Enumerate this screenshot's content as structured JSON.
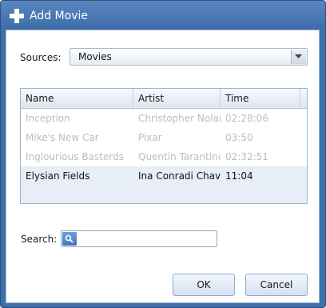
{
  "window": {
    "title": "Add Movie",
    "title_icon": "plus-icon",
    "accent_color": "#3e6fab"
  },
  "sources": {
    "label": "Sources:",
    "selected": "Movies"
  },
  "table": {
    "columns": [
      "Name",
      "Artist",
      "Time"
    ],
    "rows": [
      {
        "name": "Inception",
        "artist": "Christopher Nolan",
        "time": "02:28:06",
        "state": "disabled"
      },
      {
        "name": "Mike's New Car",
        "artist": "Pixar",
        "time": "03:50",
        "state": "disabled"
      },
      {
        "name": "Inglourious Basterds",
        "artist": "Quentin Tarantino",
        "time": "02:32:51",
        "state": "disabled"
      },
      {
        "name": "Elysian Fields",
        "artist": "Ina Conradi Chavez",
        "time": "11:04",
        "state": "enabled"
      }
    ]
  },
  "search": {
    "label": "Search:",
    "value": "",
    "icon": "search-icon"
  },
  "buttons": {
    "ok": "OK",
    "cancel": "Cancel"
  }
}
